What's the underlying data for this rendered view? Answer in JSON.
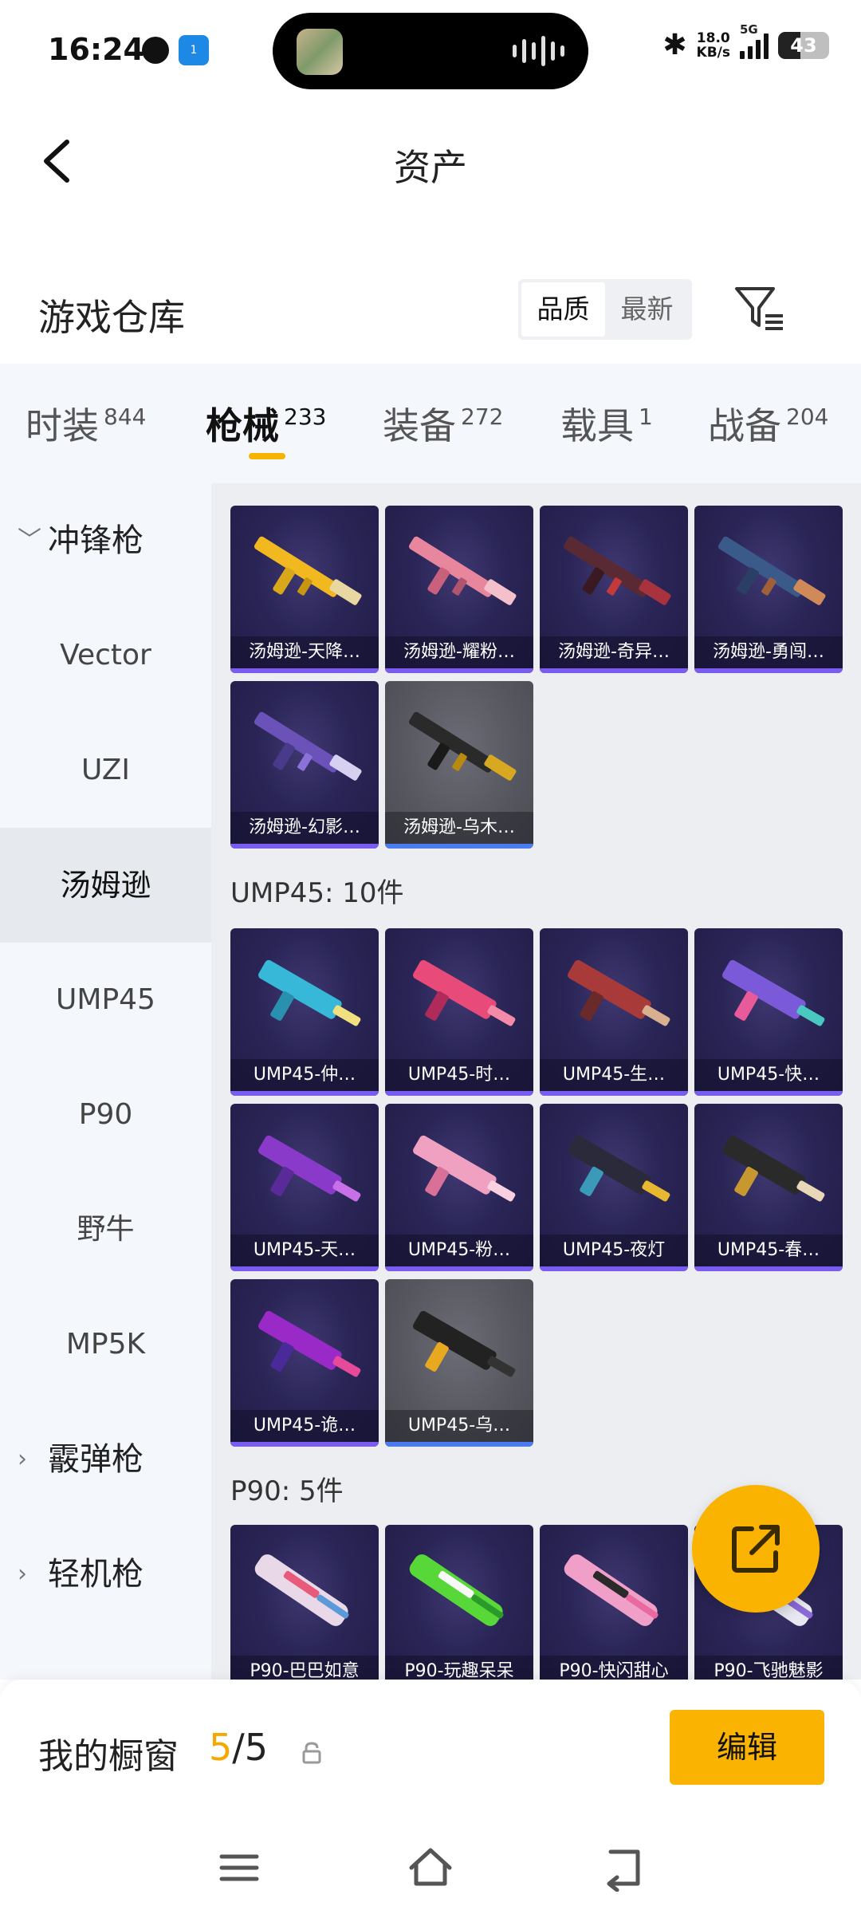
{
  "status_bar": {
    "time": "16:24",
    "app_badge": "1",
    "net_speed_value": "18.0",
    "net_speed_unit": "KB/s",
    "network": "5G",
    "battery": "43"
  },
  "header": {
    "title": "资产"
  },
  "warehouse": {
    "title": "游戏仓库",
    "sort_options": [
      "品质",
      "最新"
    ],
    "active_sort": "品质"
  },
  "tabs": [
    {
      "label": "时装",
      "count": "844"
    },
    {
      "label": "枪械",
      "count": "233",
      "active": true
    },
    {
      "label": "装备",
      "count": "272"
    },
    {
      "label": "载具",
      "count": "1"
    },
    {
      "label": "战备",
      "count": "204"
    }
  ],
  "sidebar": {
    "group_open": "冲锋枪",
    "items": [
      "Vector",
      "UZI",
      "汤姆逊",
      "UMP45",
      "P90",
      "野牛",
      "MP5K"
    ],
    "active_item": "汤姆逊",
    "groups_closed": [
      "霰弹枪",
      "轻机枪"
    ]
  },
  "sections": {
    "tommy_cards": [
      "汤姆逊-天降…",
      "汤姆逊-耀粉…",
      "汤姆逊-奇异…",
      "汤姆逊-勇闯…",
      "汤姆逊-幻影…",
      "汤姆逊-乌木…"
    ],
    "ump_title": "UMP45: 10件",
    "ump_cards": [
      "UMP45-仲…",
      "UMP45-时…",
      "UMP45-生…",
      "UMP45-快…",
      "UMP45-天…",
      "UMP45-粉…",
      "UMP45-夜灯",
      "UMP45-春…",
      "UMP45-诡…",
      "UMP45-乌…"
    ],
    "p90_title": "P90: 5件",
    "p90_cards": [
      "P90-巴巴如意",
      "P90-玩趣呆呆",
      "P90-快闪甜心",
      "P90-飞驰魅影"
    ]
  },
  "showcase": {
    "title": "我的橱窗",
    "current": "5",
    "separator": "/",
    "total": "5",
    "edit_label": "编辑"
  },
  "colors": {
    "accent": "#f9b300",
    "card_bg": "#2a2556",
    "card_bar": "#7a5cf0",
    "sidebar_bg": "#f4f7fb"
  }
}
